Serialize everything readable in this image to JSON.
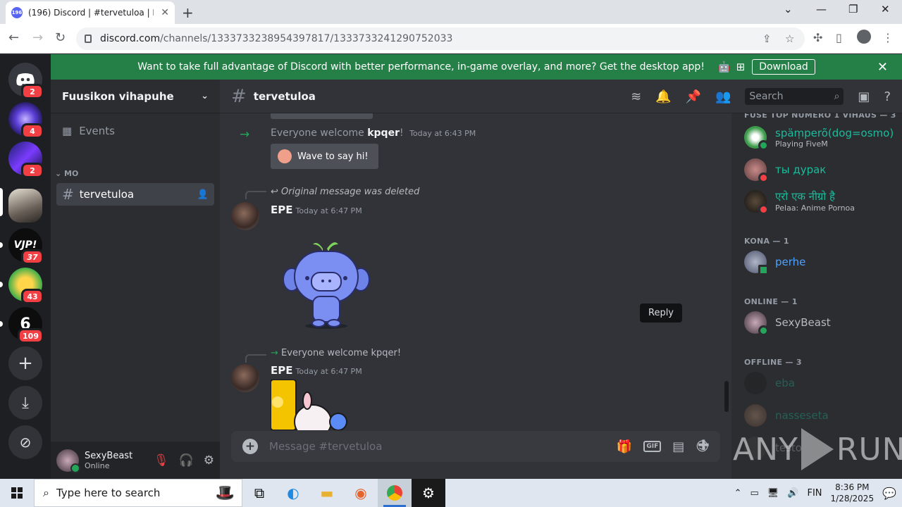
{
  "browser": {
    "tab_title": "(196) Discord | #tervetuloa | Fuus",
    "tab_badge": "196",
    "url_host": "discord.com",
    "url_path": "/channels/1333733238954397817/1333733241290752033"
  },
  "banner": {
    "text": "Want to take full advantage of Discord with better performance, in-game overlay, and more? Get the desktop app!",
    "download_label": "Download"
  },
  "guilds": [
    {
      "badge": "2"
    },
    {
      "badge": "4"
    },
    {
      "badge": "2"
    },
    {
      "badge": ""
    },
    {
      "badge": "37"
    },
    {
      "badge": "43"
    },
    {
      "badge": "109"
    }
  ],
  "server": {
    "name": "Fuusikon vihapuhe",
    "events_label": "Events",
    "category": "MO",
    "channel": "tervetuloa"
  },
  "user": {
    "name": "SexyBeast",
    "status": "Online"
  },
  "chat": {
    "channel": "tervetuloa",
    "search_placeholder": "Search",
    "welcome_prefix": "Everyone welcome ",
    "welcome_user": "kpqer",
    "welcome_suffix": "!",
    "welcome_time": "Today at 6:43 PM",
    "wave_label": "Wave to say hi!",
    "msg1_reply": "Original message was deleted",
    "msg1_author": "EPE",
    "msg1_time": "Today at 6:47 PM",
    "tooltip": "Reply",
    "msg2_reply": "Everyone welcome kpqer!",
    "msg2_author": "EPE",
    "msg2_time": "Today at 6:47 PM",
    "composer_placeholder": "Message #tervetuloa"
  },
  "members": {
    "role1_header": "FUSE TOP NUMERO 1 VIHAUS — 3",
    "m1_name": "späṃperõ(dog=osmo)",
    "m1_activity": "Playing FiveM",
    "m2_name": "ты дурак",
    "m3_name": "एरो एक नीग्रो है",
    "m3_activity": "Pelaa: Anime Pornoa",
    "role2_header": "KONA — 1",
    "m4_name": "perhe",
    "role3_header": "ONLINE — 1",
    "m5_name": "SexyBeast",
    "role4_header": "OFFLINE — 3",
    "m6_name": "eba",
    "m7_name": "nasseseta",
    "m8_name": "testo"
  },
  "watermark": {
    "left": "ANY",
    "right": "RUN"
  },
  "taskbar": {
    "search_placeholder": "Type here to search",
    "lang": "FIN",
    "time": "8:36 PM",
    "date": "1/28/2025"
  },
  "colors": {
    "blurple": "#5865f2",
    "banner_green": "#248046",
    "cyan_role": "#1abc9c",
    "blue_role": "#4ea1ff",
    "dnd_red": "#f23f43",
    "online_green": "#23a55a"
  }
}
